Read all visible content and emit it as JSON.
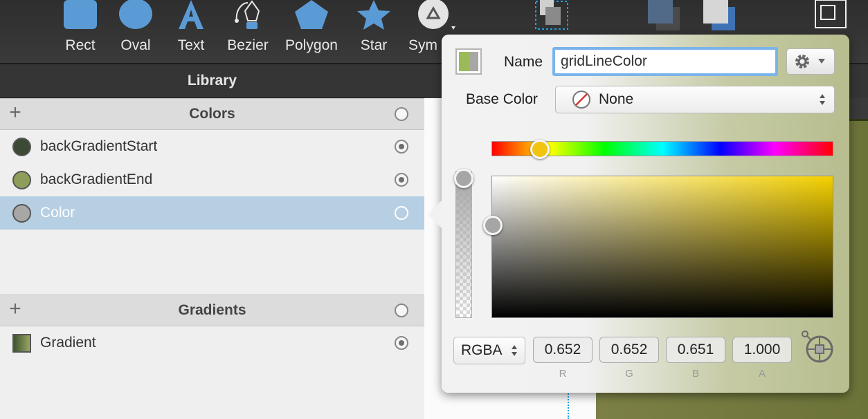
{
  "toolbar": {
    "tools": [
      {
        "label": "Rect",
        "icon": "rect-icon"
      },
      {
        "label": "Oval",
        "icon": "oval-icon"
      },
      {
        "label": "Text",
        "icon": "text-icon"
      },
      {
        "label": "Bezier",
        "icon": "bezier-icon"
      },
      {
        "label": "Polygon",
        "icon": "polygon-icon"
      },
      {
        "label": "Star",
        "icon": "star-icon"
      },
      {
        "label": "Symbol",
        "icon": "symbol-icon",
        "visible_label": "Sym"
      }
    ]
  },
  "library": {
    "header": "Library",
    "colors_section": {
      "title": "Colors",
      "items": [
        {
          "name": "backGradientStart",
          "swatch": "#3c4a35",
          "linked": true
        },
        {
          "name": "backGradientEnd",
          "swatch": "#8f9d5a",
          "linked": true
        },
        {
          "name": "Color",
          "swatch": "#a7a7a6",
          "linked": false,
          "selected": true
        }
      ]
    },
    "gradients_section": {
      "title": "Gradients",
      "items": [
        {
          "name": "Gradient",
          "swatch_from": "#3e5230",
          "swatch_to": "#97a660",
          "linked": true
        }
      ]
    }
  },
  "popover": {
    "name_label": "Name",
    "name_value": "gridLineColor",
    "base_color_label": "Base Color",
    "base_color_value": "None",
    "mode": "RGBA",
    "components": [
      {
        "label": "R",
        "value": "0.652"
      },
      {
        "label": "G",
        "value": "0.652"
      },
      {
        "label": "B",
        "value": "0.651"
      },
      {
        "label": "A",
        "value": "1.000"
      }
    ],
    "hue_color": "#f2c410",
    "current_color": "#a7a7a6",
    "previous_color": "#9bba59"
  },
  "colors": {
    "accent": "#7ab4ea",
    "selection": "#b7cfe3",
    "toolbar_icon": "#5b9bd5"
  }
}
